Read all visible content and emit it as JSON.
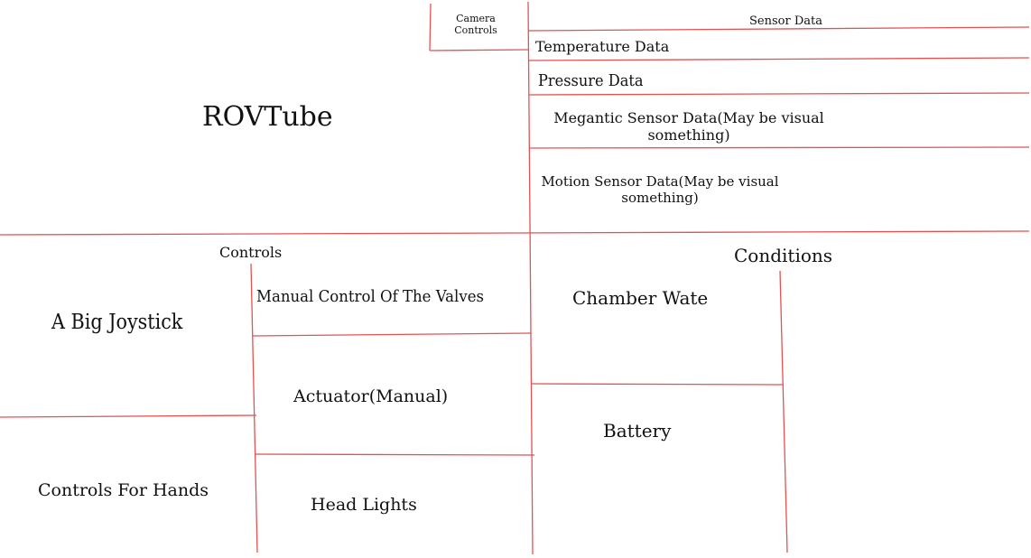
{
  "header": {
    "app_title": "ROVTube",
    "camera_controls": [
      "Camera",
      "Controls"
    ]
  },
  "sensor_panel": {
    "title": "Sensor Data",
    "items": [
      "Temperature Data",
      "Pressure Data",
      [
        "Megantic Sensor Data(May be visual",
        "something)"
      ],
      [
        "Motion Sensor Data(May be visual",
        "something)"
      ]
    ]
  },
  "controls_panel": {
    "title": "Controls",
    "joystick": "A Big Joystick",
    "hands": "Controls For Hands",
    "valves": "Manual Control Of The Valves",
    "actuator": "Actuator(Manual)",
    "head_lights": "Head Lights"
  },
  "conditions_panel": {
    "title": "Conditions",
    "chamber": "Chamber Wate",
    "battery": "Battery"
  },
  "colors": {
    "line": "#e35252",
    "text": "#111111",
    "background": "#ffffff"
  }
}
